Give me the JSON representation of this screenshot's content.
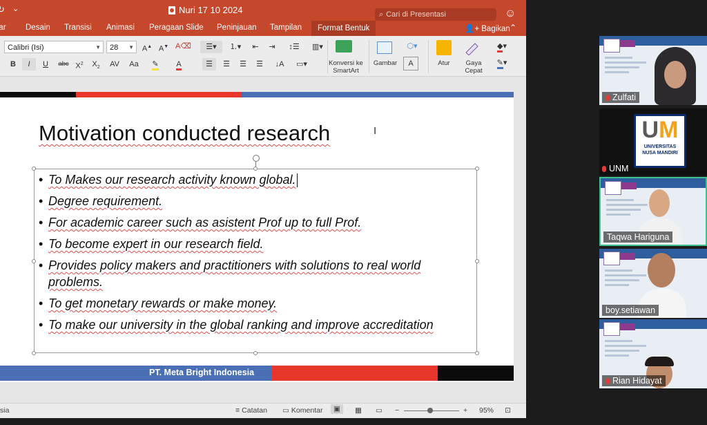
{
  "window": {
    "title": "Nuri 17 10 2024",
    "search_placeholder": "Cari di Presentasi"
  },
  "ribbon_tabs": [
    "bar",
    "Desain",
    "Transisi",
    "Animasi",
    "Peragaan Slide",
    "Peninjauan",
    "Tampilan",
    "Format Bentuk"
  ],
  "share_label": "Bagikan",
  "ribbon": {
    "font_name": "Calibri (Isi)",
    "font_size": "28",
    "convert_smartart": "Konversi ke SmartArt",
    "picture": "Gambar",
    "arrange": "Atur",
    "quick_styles": "Gaya Cepat"
  },
  "slide": {
    "title": "Motivation conducted research",
    "bullets": [
      "To Makes our research activity known global.",
      "Degree requirement.",
      "For academic career such as asistent Prof up to full Prof.",
      "To become expert in our research field.",
      "Provides policy makers and practitioners with solutions to real world problems.",
      "To get monetary rewards or make money.",
      "To make our university in the global ranking and improve accreditation"
    ],
    "footer": "PT. Meta Bright Indonesia"
  },
  "status": {
    "lang": "sia",
    "notes": "Catatan",
    "comments": "Komentar",
    "zoom": "95%"
  },
  "participants": [
    {
      "name": "Zulfati"
    },
    {
      "name": "UNM",
      "logo_text": [
        "UNIVERSITAS",
        "NUSA MANDIRI"
      ]
    },
    {
      "name": "Taqwa Hariguna"
    },
    {
      "name": "boy.setiawan"
    },
    {
      "name": "Rian Hidayat"
    }
  ],
  "colors": {
    "accent": "#c5472c",
    "footer_blue": "#4a6fb5",
    "footer_red": "#e8362b",
    "active_speaker": "#3ec28e"
  }
}
